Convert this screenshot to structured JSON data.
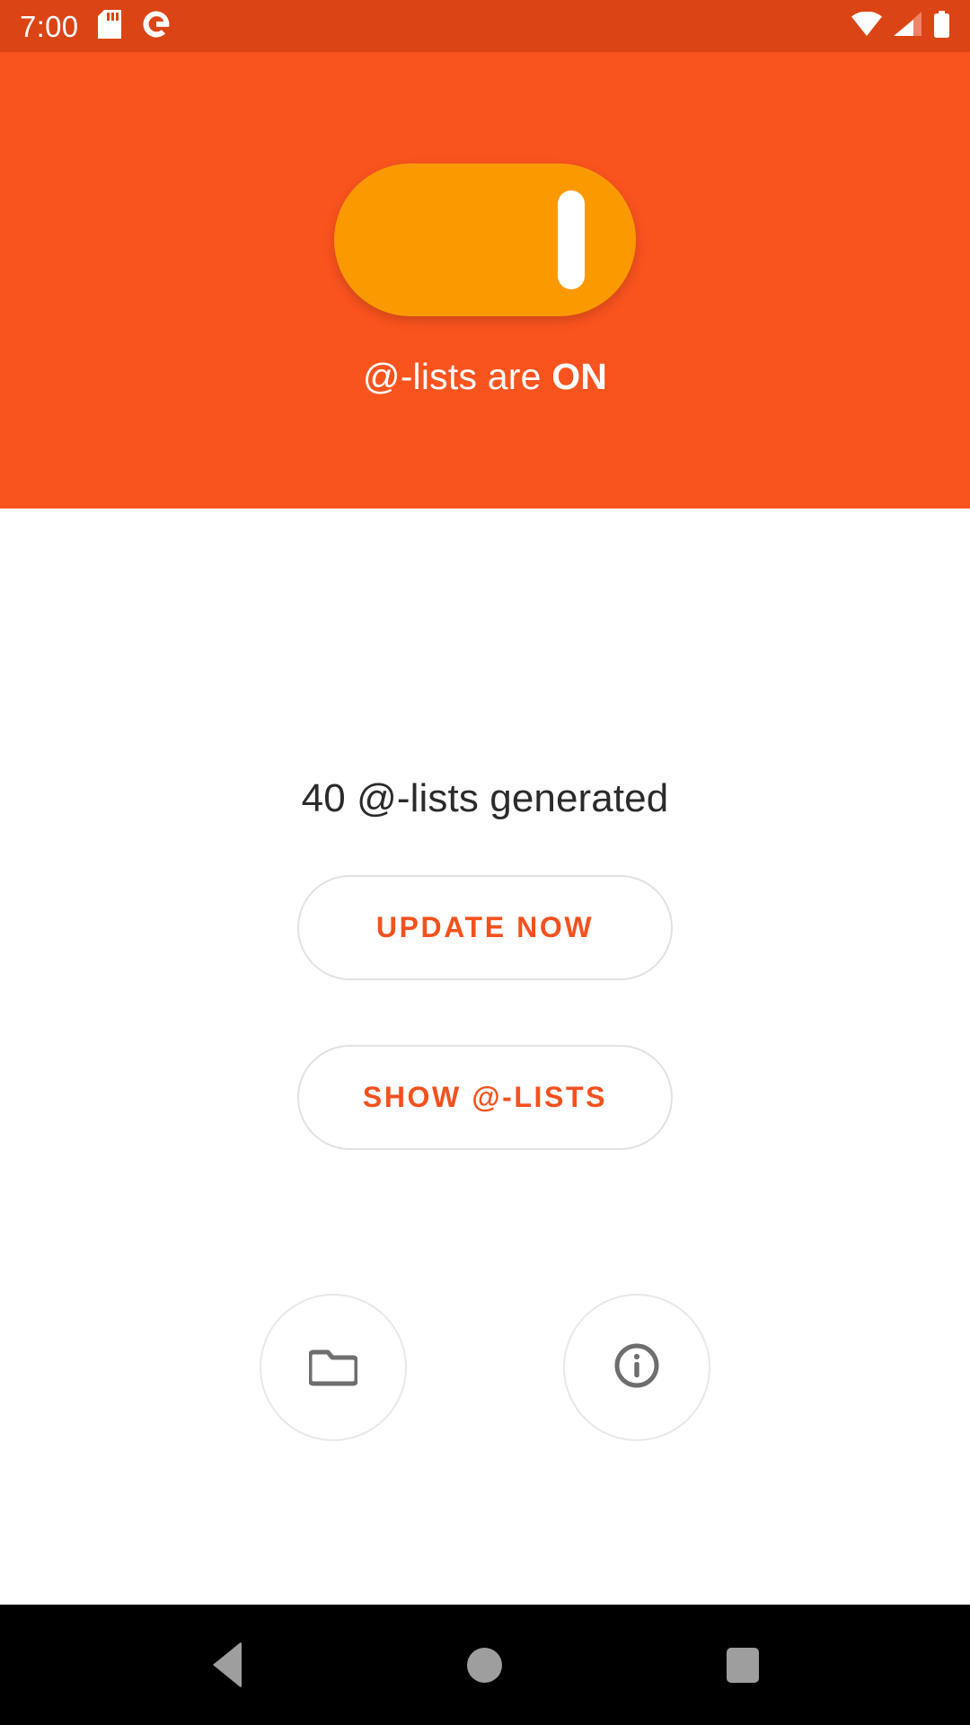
{
  "status_bar": {
    "time": "7:00",
    "icons": [
      "sd-card-icon",
      "google-icon",
      "wifi-icon",
      "cellular-signal-icon",
      "battery-icon"
    ],
    "background_color": "#DB4414",
    "foreground_color": "#FFFFFF"
  },
  "header": {
    "background_color": "#F9531E",
    "toggle": {
      "name": "main-power-toggle",
      "state": "on",
      "track_color": "#FB9A00",
      "thumb_color": "#FFFFFF"
    },
    "label_prefix": "@-lists are ",
    "label_state": "ON",
    "label_color": "#FFFFFF"
  },
  "main": {
    "status_text": "40 @-lists generated",
    "status_text_color": "#2B2B2B",
    "accent_color": "#F4511E",
    "buttons": [
      {
        "label": "UPDATE NOW",
        "name": "update-now-button"
      },
      {
        "label": "SHOW @-LISTS",
        "name": "show-at-lists-button"
      }
    ],
    "icon_buttons": [
      {
        "icon": "folder-icon",
        "name": "folder-button"
      },
      {
        "icon": "info-icon",
        "name": "info-button"
      }
    ],
    "icon_color": "#6E6E6E"
  },
  "nav_bar": {
    "background_color": "#000000",
    "icon_color": "#9E9E9E",
    "items": [
      {
        "name": "nav-back-button",
        "icon": "back-triangle-icon"
      },
      {
        "name": "nav-home-button",
        "icon": "home-circle-icon"
      },
      {
        "name": "nav-recents-button",
        "icon": "recents-square-icon"
      }
    ]
  }
}
